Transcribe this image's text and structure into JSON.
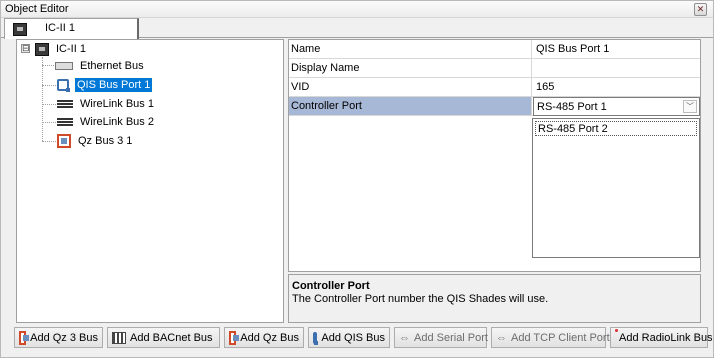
{
  "window": {
    "title": "Object Editor",
    "close_glyph": "✕"
  },
  "tab": {
    "label": "IC-II 1",
    "icon": "controller-icon"
  },
  "tree": {
    "root": {
      "label": "IC-II 1",
      "expander": "⊟",
      "icon": "controller-icon"
    },
    "children": [
      {
        "label": "Ethernet Bus",
        "icon": "ethernet-icon",
        "selected": false
      },
      {
        "label": "QIS Bus Port 1",
        "icon": "qis-bus-icon",
        "selected": true
      },
      {
        "label": "WireLink Bus 1",
        "icon": "wirelink-icon",
        "selected": false
      },
      {
        "label": "WireLink Bus 2",
        "icon": "wirelink-icon",
        "selected": false
      },
      {
        "label": "Qz Bus 3 1",
        "icon": "qz-bus-icon",
        "selected": false
      }
    ]
  },
  "properties": [
    {
      "name": "Name",
      "value": "QIS Bus Port 1"
    },
    {
      "name": "Display Name",
      "value": ""
    },
    {
      "name": "VID",
      "value": "165"
    },
    {
      "name": "Controller Port",
      "value": "RS-485 Port 1",
      "selected": true,
      "editor": "dropdown"
    }
  ],
  "dropdown": {
    "options": [
      "RS-485 Port 2"
    ],
    "arrow": "﹀"
  },
  "help": {
    "title": "Controller Port",
    "description": "The Controller Port number the QIS Shades will use."
  },
  "toolbar": {
    "buttons": [
      {
        "label": "Add Qz 3 Bus",
        "icon": "qz-bus-icon",
        "enabled": true
      },
      {
        "label": "Add BACnet Bus",
        "icon": "bacnet-icon",
        "enabled": true
      },
      {
        "label": "Add Qz Bus",
        "icon": "qz-bus-icon",
        "enabled": true
      },
      {
        "label": "Add QIS Bus",
        "icon": "qis-bus-icon",
        "enabled": true
      },
      {
        "label": "Add Serial Port",
        "icon": "serial-port-icon",
        "enabled": false
      },
      {
        "label": "Add TCP Client Port",
        "icon": "tcp-port-icon",
        "enabled": false
      },
      {
        "label": "Add RadioLink Bus",
        "icon": "radiolink-icon",
        "enabled": true
      }
    ],
    "serial_glyph": "⇔"
  }
}
